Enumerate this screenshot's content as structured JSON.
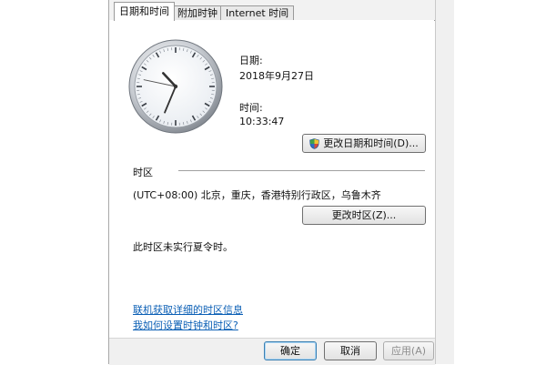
{
  "tabs": [
    {
      "label": "日期和时间",
      "active": true
    },
    {
      "label": "附加时钟",
      "active": false
    },
    {
      "label": "Internet 时间",
      "active": false
    }
  ],
  "clock": {
    "hour": 10,
    "minute": 33,
    "second": 47
  },
  "date": {
    "label": "日期:",
    "value": "2018年9月27日"
  },
  "time": {
    "label": "时间:",
    "value": "10:33:47"
  },
  "change_datetime_button": "更改日期和时间(D)...",
  "timezone": {
    "section_label": "时区",
    "value": "(UTC+08:00) 北京，重庆，香港特别行政区，乌鲁木齐",
    "change_button": "更改时区(Z)..."
  },
  "dst_note": "此时区未实行夏令时。",
  "links": {
    "online_info": "联机获取详细的时区信息",
    "how_to": "我如何设置时钟和时区?"
  },
  "footer": {
    "ok": "确定",
    "cancel": "取消",
    "apply": "应用(A)"
  },
  "colors": {
    "link": "#0b5fb5",
    "default_button_border": "#3c7fb1"
  }
}
